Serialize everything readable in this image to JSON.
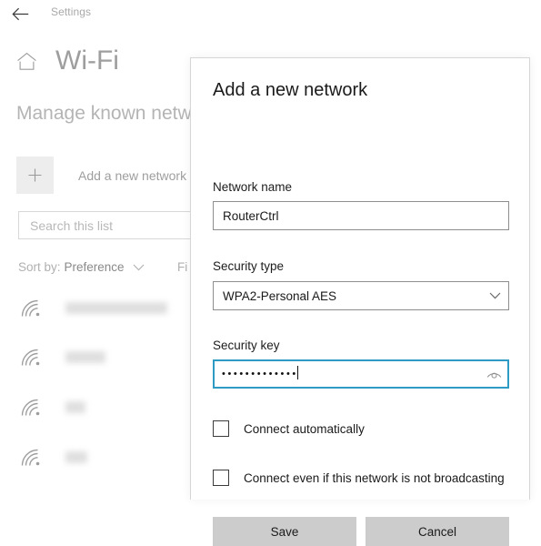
{
  "window": {
    "back_icon": "back-arrow-icon",
    "app_title": "Settings"
  },
  "settings_page": {
    "home_icon": "home-icon",
    "page_title": "Wi-Fi",
    "section_title": "Manage known networks",
    "add_network": {
      "plus_icon": "plus-icon",
      "label": "Add a new network"
    },
    "search": {
      "placeholder": "Search this list",
      "value": ""
    },
    "sort": {
      "label": "Sort by:",
      "value": "Preference",
      "chevron_icon": "chevron-down-icon"
    },
    "filter": {
      "label": "Fi"
    },
    "networks": [
      {
        "icon": "wifi-icon",
        "name": "",
        "name_width": 112
      },
      {
        "icon": "wifi-icon",
        "name": "",
        "name_width": 44
      },
      {
        "icon": "wifi-icon",
        "name": "",
        "name_width": 22
      },
      {
        "icon": "wifi-icon",
        "name": "",
        "name_width": 24
      }
    ]
  },
  "dialog": {
    "title": "Add a new network",
    "network_name": {
      "label": "Network name",
      "value": "RouterCtrl",
      "placeholder": ""
    },
    "security_type": {
      "label": "Security type",
      "value": "WPA2-Personal AES",
      "chevron_icon": "chevron-down-icon",
      "options": [
        "WPA2-Personal AES"
      ]
    },
    "security_key": {
      "label": "Security key",
      "value": "•••••••••••••",
      "masked_length": 13,
      "reveal_icon": "eye-icon",
      "focused": true
    },
    "checkboxes": [
      {
        "label": "Connect automatically",
        "checked": false
      },
      {
        "label": "Connect even if this network is not broadcasting",
        "checked": false
      }
    ],
    "buttons": {
      "save_label": "Save",
      "cancel_label": "Cancel"
    }
  },
  "colors": {
    "focus_border": "#2e9bc5",
    "button_bg": "#cccccc",
    "input_border": "#8e8e8e",
    "muted_text": "#9e9e9e"
  }
}
